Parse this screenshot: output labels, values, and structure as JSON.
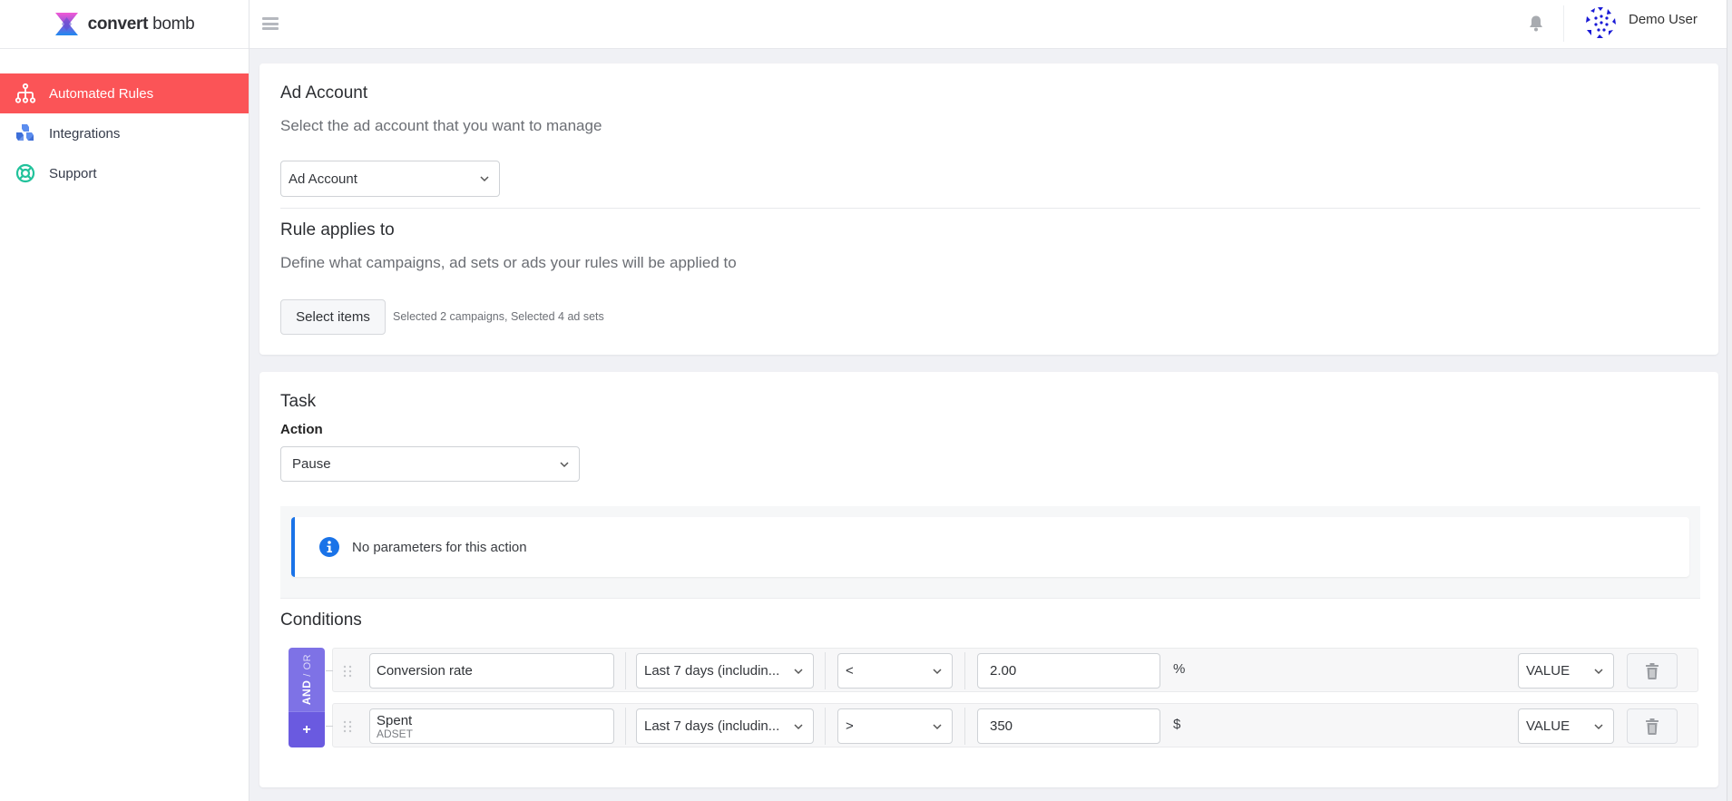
{
  "brand": {
    "name_bold": "convert",
    "name_light": " bomb"
  },
  "sidebar": {
    "items": [
      {
        "label": "Automated Rules",
        "icon": "sitemap-icon",
        "active": true
      },
      {
        "label": "Integrations",
        "icon": "cubes-icon",
        "active": false
      },
      {
        "label": "Support",
        "icon": "life-ring-icon",
        "active": false
      }
    ]
  },
  "header": {
    "user_name": "Demo User"
  },
  "ad_account": {
    "title": "Ad Account",
    "subtitle": "Select the ad account that you want to manage",
    "select_value": "Ad Account"
  },
  "rule_applies": {
    "title": "Rule applies to",
    "subtitle": "Define what campaigns, ad sets or ads your rules will be applied to",
    "button_label": "Select items",
    "selection_note": "Selected 2 campaigns, Selected 4 ad sets"
  },
  "task": {
    "title": "Task",
    "action_label": "Action",
    "action_value": "Pause",
    "info_text": "No parameters for this action"
  },
  "conditions": {
    "title": "Conditions",
    "and_label": "AND",
    "slash": "/",
    "or_label": "OR",
    "add_label": "+",
    "rows": [
      {
        "metric": "Conversion rate",
        "level": "",
        "period": "Last 7 days (includin...",
        "operator": "<",
        "value": "2.00",
        "unit": "%",
        "value_type": "VALUE"
      },
      {
        "metric": "Spent",
        "level": "ADSET",
        "period": "Last 7 days (includin...",
        "operator": ">",
        "value": "350",
        "unit": "$",
        "value_type": "VALUE"
      }
    ]
  },
  "colors": {
    "active_nav": "#fb5457",
    "andor_purple": "#7e72e6",
    "add_purple": "#6a5ae0",
    "info_blue": "#1a73e8"
  }
}
